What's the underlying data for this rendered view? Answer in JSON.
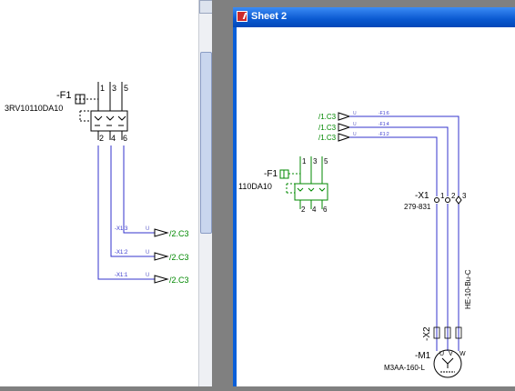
{
  "left_sheet": {
    "device_tag": "-F1",
    "device_part": "3RV10110DA10",
    "top_terminals": [
      "1",
      "3",
      "5"
    ],
    "bottom_terminals": [
      "2",
      "4",
      "6"
    ],
    "wire_labels": [
      "-X1:3",
      "-X1:2",
      "-X1:1"
    ],
    "wire_color_marks": [
      "U",
      "U",
      "U"
    ],
    "cross_refs": [
      "/2.C3",
      "/2.C3",
      "/2.C3"
    ]
  },
  "sheet_window": {
    "title": "Sheet 2",
    "incoming_refs": [
      "/1.C3",
      "/1.C3",
      "/1.C3"
    ],
    "incoming_wire_labels": [
      "-F1:6",
      "-F1:4",
      "-F1:2"
    ],
    "device_tag": "-F1",
    "device_part": "110DA10",
    "top_terminals": [
      "1",
      "3",
      "5"
    ],
    "bottom_terminals": [
      "2",
      "4",
      "6"
    ],
    "terminal_strip_tag": "-X1",
    "terminal_strip_part": "279-831",
    "terminal_numbers": [
      "1",
      "2",
      "3"
    ],
    "connector_tag": "-X2",
    "cable_label": "HE-10-Bu-C",
    "motor_tag": "-M1",
    "motor_part": "M3AA-160-L",
    "motor_terminals": [
      "U",
      "V",
      "W"
    ]
  },
  "colors": {
    "wire": "#3333cc",
    "green": "#008800",
    "title_blue": "#0a5fd8"
  }
}
